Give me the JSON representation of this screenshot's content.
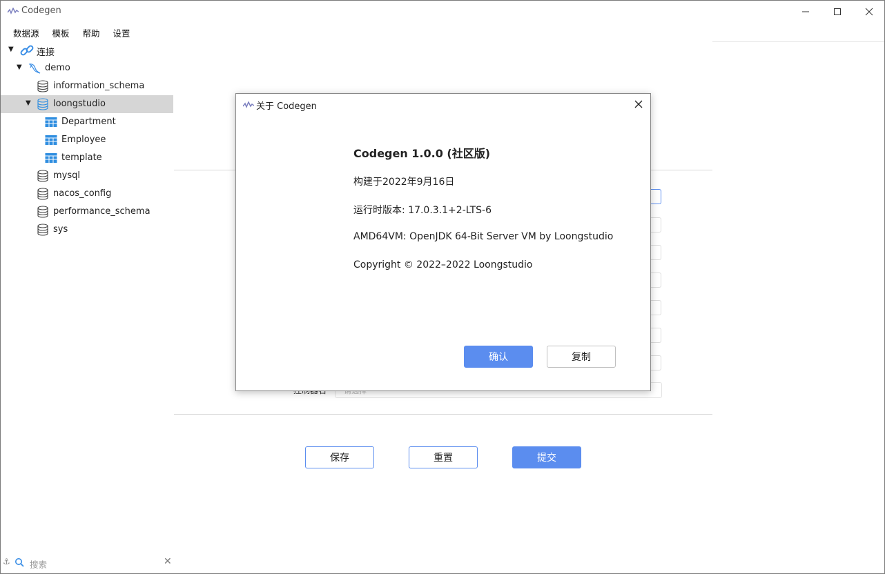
{
  "window": {
    "title": "Codegen",
    "controls": {
      "minimize": "—",
      "maximize": "☐",
      "close": "✕"
    }
  },
  "menu": [
    "数据源",
    "模板",
    "帮助",
    "设置"
  ],
  "tree": {
    "root": {
      "label": "连接",
      "icon": "link-icon"
    },
    "connection": {
      "label": "demo",
      "icon": "mysql-dolphin-icon"
    },
    "databases": [
      {
        "label": "information_schema"
      },
      {
        "label": "loongstudio",
        "selected": true,
        "tables": [
          "Department",
          "Employee",
          "template"
        ]
      },
      {
        "label": "mysql"
      },
      {
        "label": "nacos_config"
      },
      {
        "label": "performance_schema"
      },
      {
        "label": "sys"
      }
    ]
  },
  "form": {
    "partial_label": "控制器名",
    "partial_placeholder": "请选择",
    "buttons": {
      "save": "保存",
      "reset": "重置",
      "submit": "提交"
    }
  },
  "search": {
    "placeholder": "搜索"
  },
  "about_dialog": {
    "title": "关于 Codegen",
    "heading": "Codegen 1.0.0 (社区版)",
    "lines": [
      "构建于2022年9月16日",
      "运行时版本: 17.0.3.1+2-LTS-6",
      "AMD64VM: OpenJDK 64-Bit Server VM by Loongstudio",
      "Copyright © 2022–2022 Loongstudio"
    ],
    "confirm": "确认",
    "copy": "复制"
  },
  "colors": {
    "accent": "#5b8def",
    "selection": "#d6d6d6",
    "table_icon": "#2f8ee0"
  }
}
